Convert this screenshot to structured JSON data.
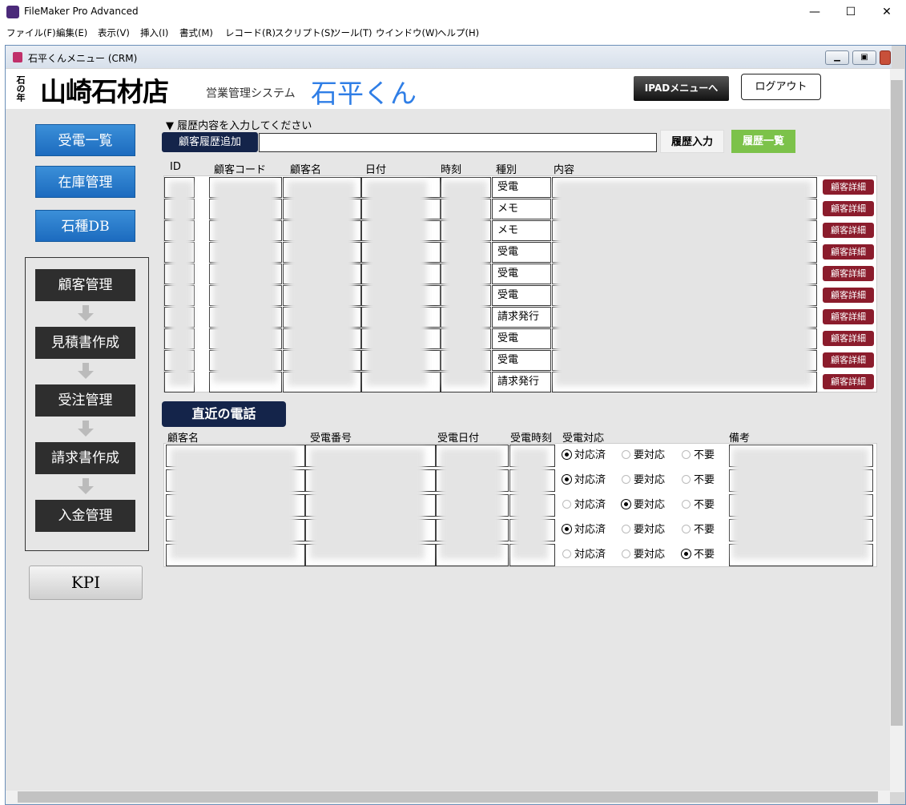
{
  "app": {
    "title": "FileMaker Pro Advanced",
    "min": "—",
    "max": "☐",
    "close": "✕"
  },
  "menu": [
    "ファイル(F)",
    "編集(E)",
    "表示(V)",
    "挿入(I)",
    "書式(M)",
    "レコード(R)",
    "スクリプト(S)",
    "ツール(T)",
    "ウインドウ(W)",
    "ヘルプ(H)"
  ],
  "doc": {
    "title": "石平くんメニュー (CRM)"
  },
  "header": {
    "company": "山崎石材店",
    "company_small": "石の年",
    "sys_label": "営業管理システム",
    "sys_name": "石平くん",
    "ipad_btn": "IPADメニューへ",
    "logout_btn": "ログアウト"
  },
  "nav": {
    "calls": "受電一覧",
    "stock": "在庫管理",
    "stone_db": "石種DB",
    "kpi": "KPI"
  },
  "flow": [
    "顧客管理",
    "見積書作成",
    "受注管理",
    "請求書作成",
    "入金管理"
  ],
  "history_form": {
    "prompt": "▼ 履歴内容を入力してください",
    "add_label": "顧客履歴追加",
    "input_value": "",
    "submit": "履歴入力",
    "list_btn": "履歴一覧"
  },
  "history_table": {
    "headers": [
      "ID",
      "顧客コード",
      "顧客名",
      "日付",
      "時刻",
      "種別",
      "内容"
    ],
    "types": [
      "受電",
      "メモ",
      "メモ",
      "受電",
      "受電",
      "受電",
      "請求発行",
      "受電",
      "受電",
      "請求発行"
    ],
    "detail_btn": "顧客詳細"
  },
  "recent_calls": {
    "title": "直近の電話",
    "headers": [
      "顧客名",
      "受電番号",
      "受電日付",
      "受電時刻",
      "受電対応",
      "備考"
    ],
    "options": [
      "対応済",
      "要対応",
      "不要"
    ],
    "rows": [
      {
        "status": "対応済"
      },
      {
        "status": "対応済"
      },
      {
        "status": "要対応"
      },
      {
        "status": "対応済"
      },
      {
        "status": "不要"
      }
    ]
  }
}
